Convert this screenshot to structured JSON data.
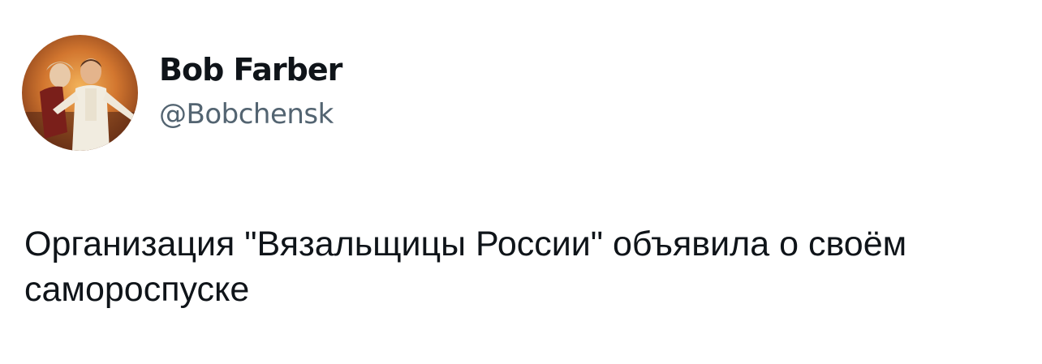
{
  "author": {
    "display_name": "Bob Farber",
    "handle": "@Bobchensk",
    "avatar_icon": "profile-photo"
  },
  "tweet": {
    "text": "Организация \"Вязальщицы России\" объявила о своём самороспуске"
  },
  "colors": {
    "background": "#ffffff",
    "text_primary": "#0f1419",
    "text_secondary": "#536471"
  }
}
